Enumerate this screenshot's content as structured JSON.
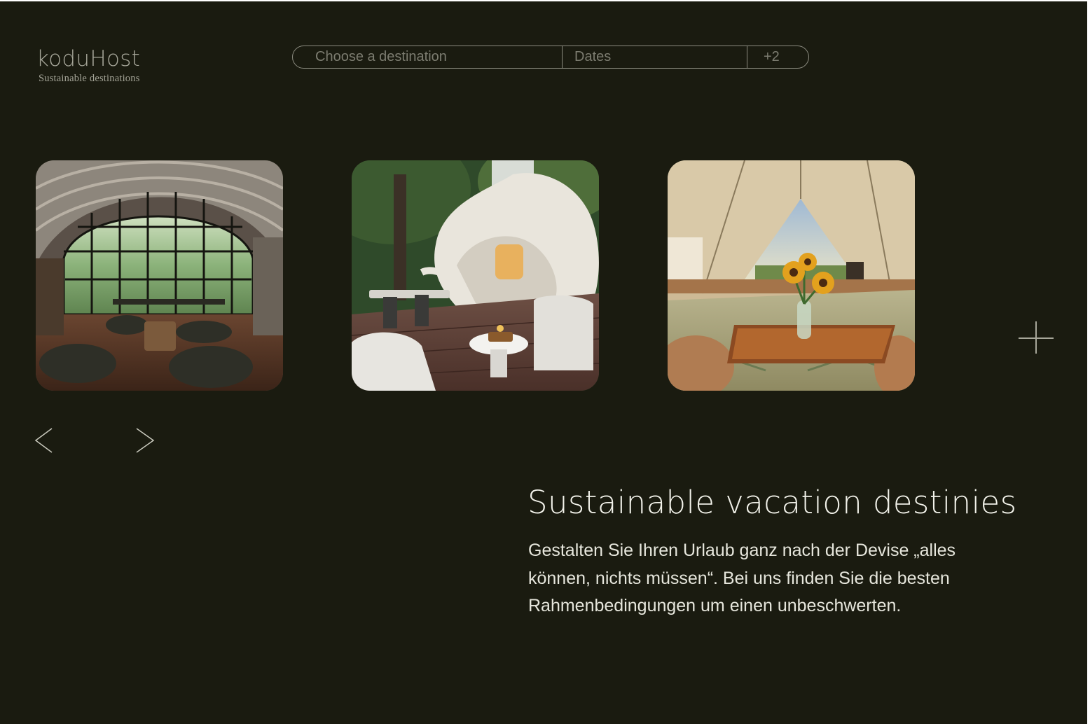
{
  "brand": {
    "name": "koduHost",
    "tagline": "Sustainable destinations"
  },
  "search": {
    "destination_placeholder": "Choose a destination",
    "dates_label": "Dates",
    "guests_label": "+2"
  },
  "cards": [
    {
      "icon": "jungle-glass-house-photo"
    },
    {
      "icon": "sculpted-white-house-deck-photo"
    },
    {
      "icon": "glamping-tent-sunflowers-photo"
    }
  ],
  "hero": {
    "title": "Sustainable vacation destinies",
    "description": "Gestalten Sie Ihren Urlaub ganz nach der Devise „alles können, nichts müssen“. Bei uns finden Sie die besten Rahmenbedingungen um einen unbeschwerten."
  },
  "icons": {
    "add": "plus-icon",
    "prev": "chevron-left-icon",
    "next": "chevron-right-icon"
  },
  "colors": {
    "background": "#1a1b10",
    "text": "#f2f2ea",
    "muted": "#8c8c80"
  }
}
